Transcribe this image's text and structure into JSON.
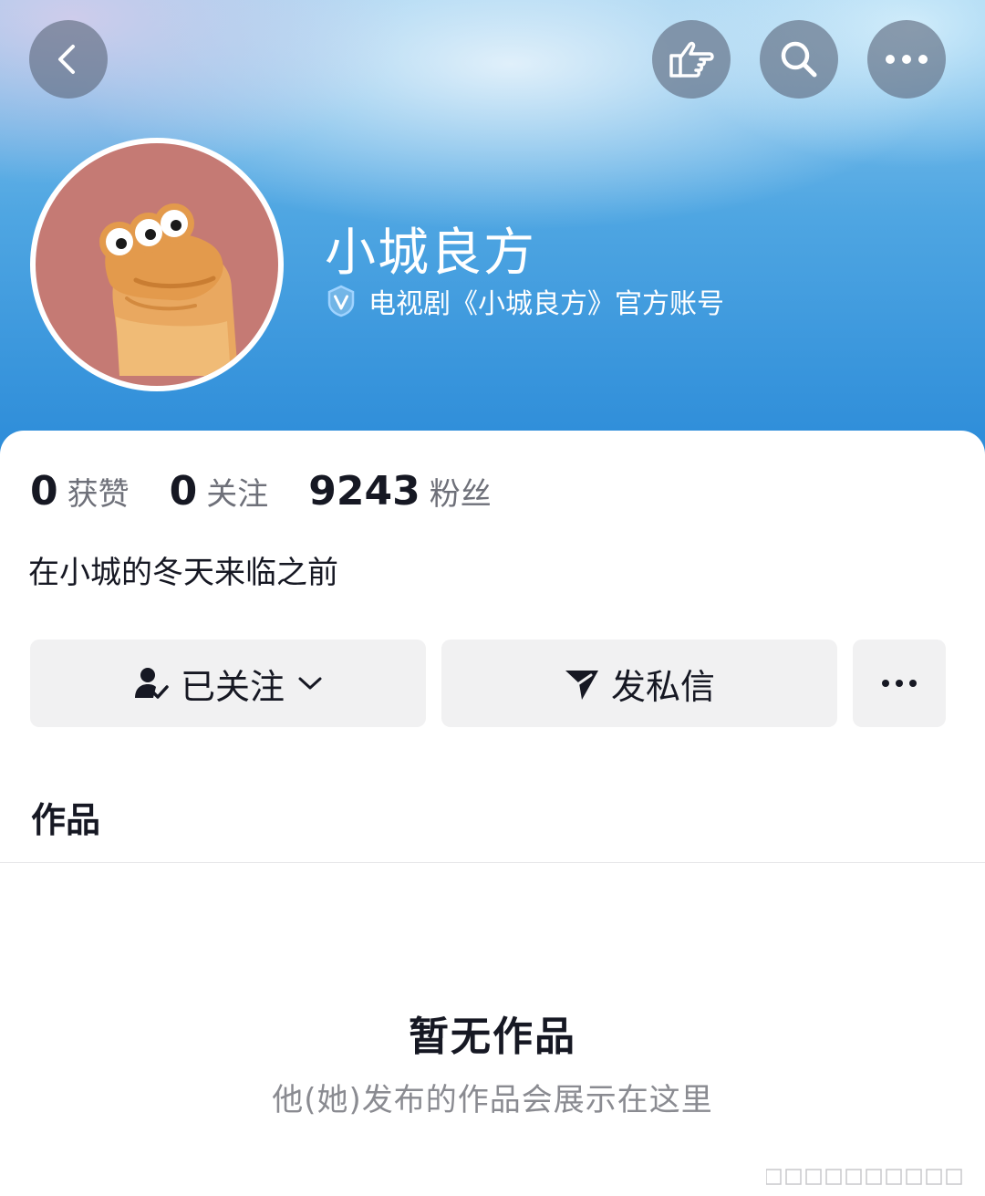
{
  "header": {
    "icons": [
      "back-icon",
      "pointing-hand-icon",
      "search-icon",
      "more-icon"
    ],
    "colors": {
      "top": "#8cc8ee",
      "bottom": "#2a8ad8"
    }
  },
  "profile": {
    "name": "小城良方",
    "verified_icon": "verified-v-icon",
    "verified_label": "电视剧《小城良方》官方账号",
    "avatar": "cartoon-character-avatar",
    "bio": "在小城的冬天来临之前"
  },
  "stats": [
    {
      "value": "0",
      "label": "获赞"
    },
    {
      "value": "0",
      "label": "关注"
    },
    {
      "value": "9243",
      "label": "粉丝"
    }
  ],
  "actions": {
    "follow_label": "已关注",
    "follow_icon": "user-check-icon",
    "follow_chevron": "chevron-down-icon",
    "message_label": "发私信",
    "message_icon": "paper-plane-icon",
    "more_icon": "more-icon"
  },
  "tabs": {
    "works": "作品"
  },
  "empty": {
    "title": "暂无作品",
    "subtitle": "他(她)发布的作品会展示在这里"
  }
}
